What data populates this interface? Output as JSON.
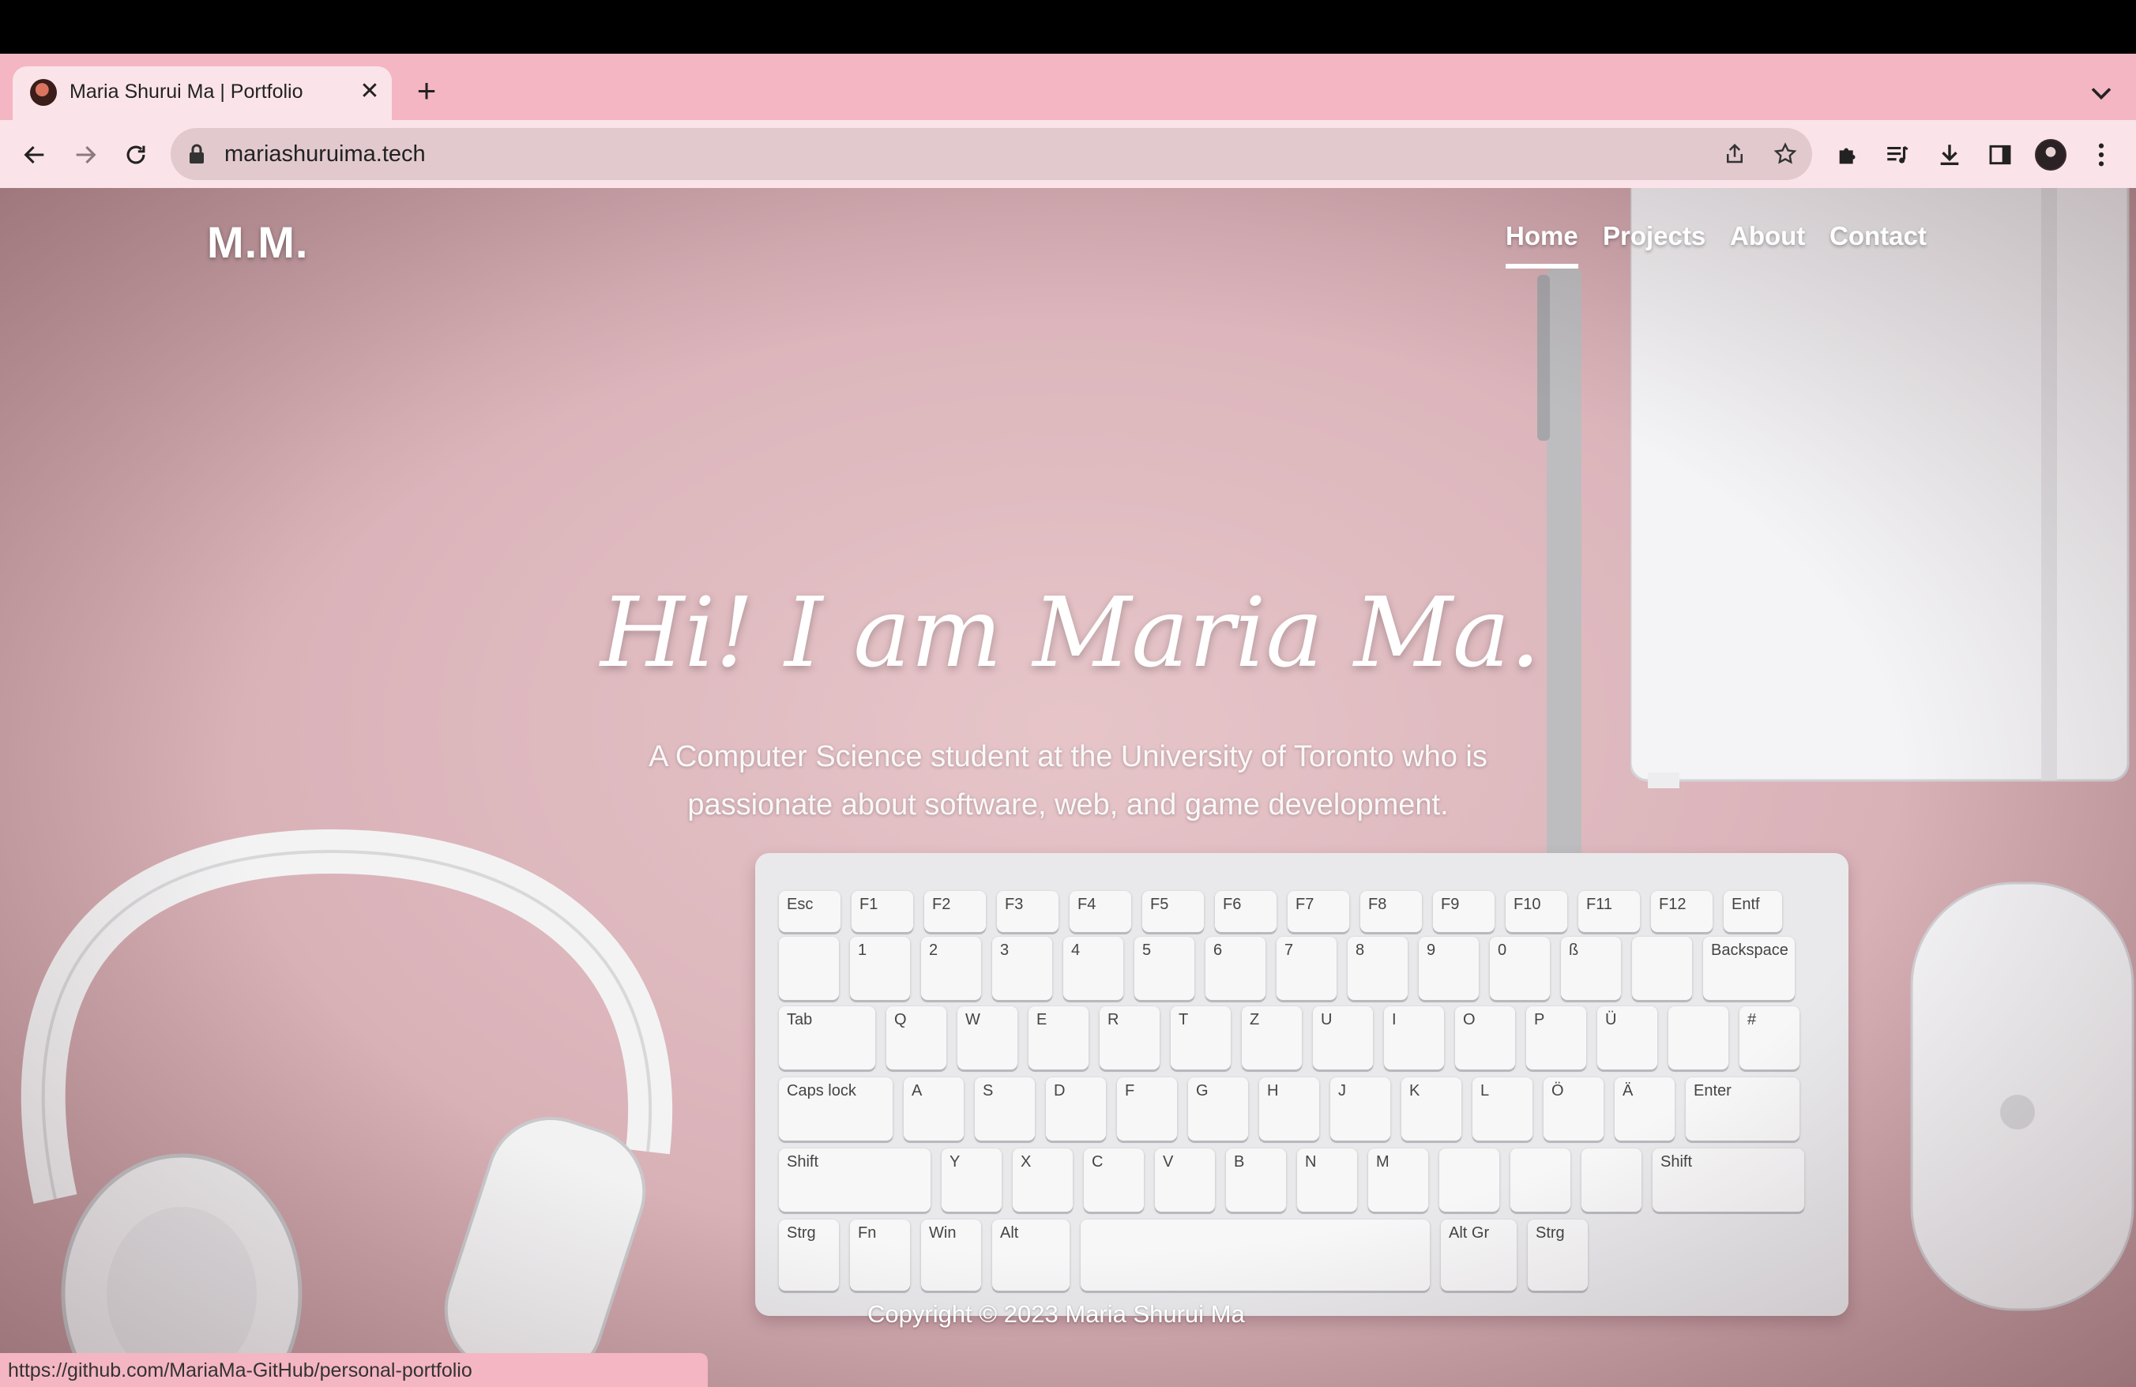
{
  "browser": {
    "tab": {
      "title": "Maria Shurui Ma | Portfolio",
      "favicon": "site-favicon"
    },
    "address": {
      "url": "mariashuruima.tech"
    },
    "status_url": "https://github.com/MariaMa-GitHub/personal-portfolio"
  },
  "site": {
    "logo": "M.M.",
    "nav": [
      {
        "label": "Home",
        "active": true
      },
      {
        "label": "Projects",
        "active": false
      },
      {
        "label": "About",
        "active": false
      },
      {
        "label": "Contact",
        "active": false
      }
    ],
    "hero": {
      "title": "Hi! I am Maria Ma.",
      "subtitle": "A Computer Science student at the University of Toronto who is passionate about software, web, and game development."
    },
    "footer": {
      "copyright": "Copyright © 2023 Maria Shurui Ma"
    }
  },
  "keyboard_legends": [
    "Esc",
    "F1",
    "F2",
    "F3",
    "F4",
    "F5",
    "F6",
    "F7",
    "F8",
    "F9",
    "F10",
    "F11",
    "F12",
    "Entf",
    "1",
    "2",
    "3",
    "4",
    "5",
    "6",
    "7",
    "8",
    "9",
    "0",
    "ß",
    "Backspace",
    "Tab",
    "Q",
    "W",
    "E",
    "R",
    "T",
    "Z",
    "U",
    "I",
    "O",
    "P",
    "Ü",
    "#",
    "Caps lock",
    "A",
    "S",
    "D",
    "F",
    "G",
    "H",
    "J",
    "K",
    "L",
    "Ö",
    "Ä",
    "Enter",
    "Shift",
    "Y",
    "X",
    "C",
    "V",
    "B",
    "N",
    "M",
    "Shift",
    "Strg",
    "Fn",
    "Win",
    "Alt",
    "Alt Gr",
    "Strg"
  ],
  "colors": {
    "tabstrip": "#f4b6c2",
    "toolbar": "#fbe4e9",
    "omnibox": "#e2c9ce",
    "page_bg": "#e2bfc4",
    "text_white": "#ffffff"
  }
}
